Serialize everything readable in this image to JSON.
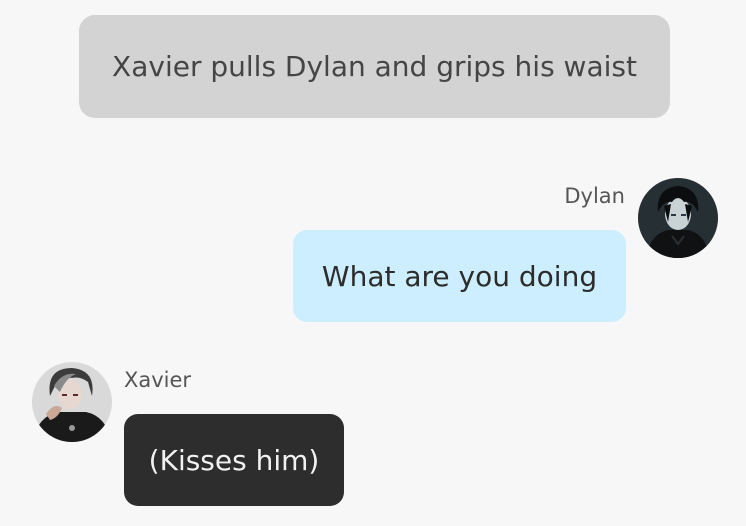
{
  "messages": {
    "narration": "Xavier pulls Dylan and grips his waist",
    "user": {
      "name": "Dylan",
      "text": "What are you doing",
      "avatar_icon": "dark-haired-character-avatar"
    },
    "character": {
      "name": "Xavier",
      "text": "(Kisses him)",
      "avatar_icon": "silver-haired-character-avatar"
    }
  },
  "colors": {
    "background": "#f7f7f7",
    "narration_bubble": "#d3d3d3",
    "user_bubble": "#cdeefe",
    "character_bubble": "#2d2d2d"
  }
}
